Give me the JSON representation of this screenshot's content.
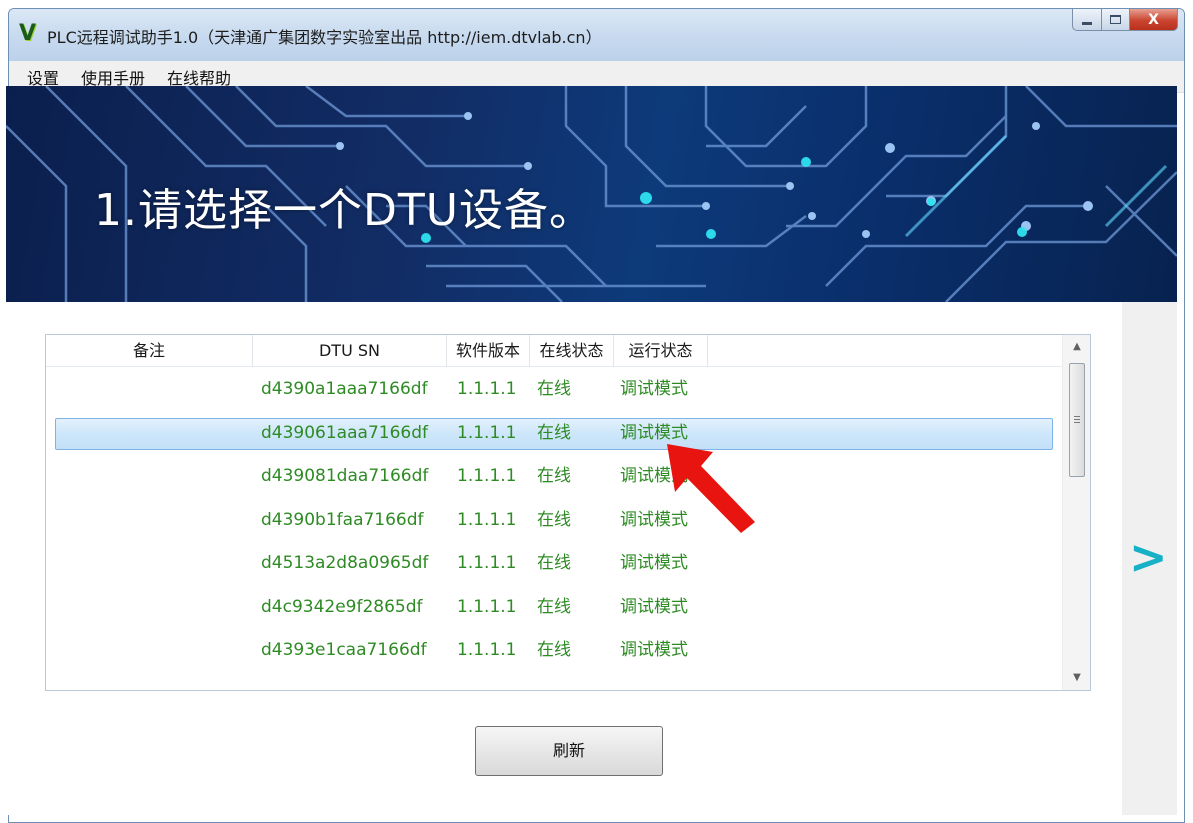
{
  "window": {
    "title": "PLC远程调试助手1.0（天津通广集团数字实验室出品 http://iem.dtvlab.cn）",
    "icon": "V",
    "controls": {
      "minimize": "minimize-icon",
      "maximize": "maximize-icon",
      "close": "X"
    }
  },
  "menu": {
    "items": [
      "设置",
      "使用手册",
      "在线帮助"
    ]
  },
  "banner": {
    "title": "1.请选择一个DTU设备。"
  },
  "device_list": {
    "columns": [
      "备注",
      "DTU SN",
      "软件版本",
      "在线状态",
      "运行状态"
    ],
    "rows": [
      {
        "note": "",
        "sn": "d4390a1aaa7166df",
        "version": "1.1.1.1",
        "online": "在线",
        "run": "调试模式"
      },
      {
        "note": "",
        "sn": "d439061aaa7166df",
        "version": "1.1.1.1",
        "online": "在线",
        "run": "调试模式"
      },
      {
        "note": "",
        "sn": "d439081daa7166df",
        "version": "1.1.1.1",
        "online": "在线",
        "run": "调试模式"
      },
      {
        "note": "",
        "sn": "d4390b1faa7166df",
        "version": "1.1.1.1",
        "online": "在线",
        "run": "调试模式"
      },
      {
        "note": "",
        "sn": "d4513a2d8a0965df",
        "version": "1.1.1.1",
        "online": "在线",
        "run": "调试模式"
      },
      {
        "note": "",
        "sn": "d4c9342e9f2865df",
        "version": "1.1.1.1",
        "online": "在线",
        "run": "调试模式"
      },
      {
        "note": "",
        "sn": "d4393e1caa7166df",
        "version": "1.1.1.1",
        "online": "在线",
        "run": "调试模式"
      }
    ],
    "selected_row": 2
  },
  "buttons": {
    "refresh": "刷新",
    "next": ">"
  },
  "colors": {
    "cell_text": "#2e8b24",
    "next_arrow": "#16b1c6",
    "annotation_arrow": "#e8140f",
    "selection": "#cde6fa"
  }
}
